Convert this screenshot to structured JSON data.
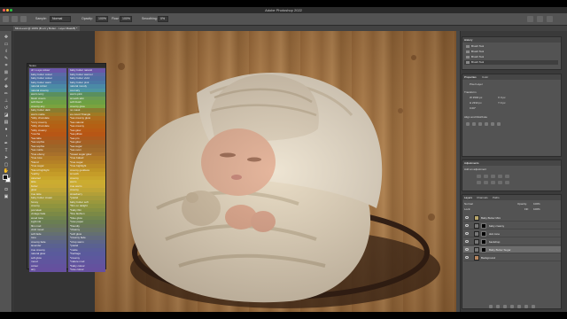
{
  "window": {
    "title": "Adobe Photoshop 2022"
  },
  "document": {
    "tab_label": "Mini-Level @ 100% (B a b y Butter... Layer Mask/8) *"
  },
  "options_bar": {
    "sample_label": "Sample:",
    "sample_value": "Normal",
    "opacity_label": "Opacity:",
    "opacity_value": "100%",
    "flow_label": "Flow:",
    "flow_value": "100%",
    "smoothing_label": "Smoothing:",
    "smoothing_value": "0%"
  },
  "notes_panel": {
    "title": "Notes",
    "left_column": [
      {
        "label": "dr t s eye colour",
        "color": "#6a56a8"
      },
      {
        "label": "baby butter colour",
        "color": "#5a6aa6"
      },
      {
        "label": "baby butter colour",
        "color": "#4f6ea3"
      },
      {
        "label": "baby butter warm",
        "color": "#4a78a4"
      },
      {
        "label": "natural colour",
        "color": "#4b8aa6"
      },
      {
        "label": "natural creamy",
        "color": "#4d95a0"
      },
      {
        "label": "warm ivory",
        "color": "#5a8f5e"
      },
      {
        "label": "blush cream",
        "color": "#6b9a53"
      },
      {
        "label": "soft blend",
        "color": "#6da043"
      },
      {
        "label": "creamy airy",
        "color": "#7aa33e"
      },
      {
        "label": "baby butter dark",
        "color": "#8a7c2f"
      },
      {
        "label": "warm matte",
        "color": "#a07a24"
      },
      {
        "label": "*silky chocolate",
        "color": "#ad6c1d"
      },
      {
        "label": "*cozy creamy",
        "color": "#b06417"
      },
      {
        "label": "*silky chocolate",
        "color": "#b46014"
      },
      {
        "label": "*silky creamy",
        "color": "#b85a14"
      },
      {
        "label": "*mocha",
        "color": "#b75615"
      },
      {
        "label": "*tea latte",
        "color": "#ad5a1c"
      },
      {
        "label": "*tea sophia",
        "color": "#a46024"
      },
      {
        "label": "*tea sophia",
        "color": "#9d6528"
      },
      {
        "label": "*tea matte",
        "color": "#a06a2a"
      },
      {
        "label": "*true ebony",
        "color": "#a8702a"
      },
      {
        "label": "*true luxe",
        "color": "#b07a27"
      },
      {
        "label": "*blend",
        "color": "#b58126"
      },
      {
        "label": "*true sugar",
        "color": "#ba8a25"
      },
      {
        "label": "*blend highlight",
        "color": "#bf9425"
      },
      {
        "label": "*earthy",
        "color": "#c59c28"
      },
      {
        "label": "caramel",
        "color": "#c9a52c"
      },
      {
        "label": "latte",
        "color": "#cbac30"
      },
      {
        "label": "butter",
        "color": "#caa933"
      },
      {
        "label": "glow",
        "color": "#bfa535"
      },
      {
        "label": "true latte",
        "color": "#b29f38"
      },
      {
        "label": "baby butter cream",
        "color": "#a59a3a"
      },
      {
        "label": "honey",
        "color": "#9a983c"
      },
      {
        "label": "creamy",
        "color": "#8f943e"
      },
      {
        "label": "porcelain",
        "color": "#858f42"
      },
      {
        "label": "vintage fade",
        "color": "#7b8946"
      },
      {
        "label": "wood tone",
        "color": "#71844c"
      },
      {
        "label": "Light ink",
        "color": "#6a7e52"
      },
      {
        "label": "film mod",
        "color": "#6a785a"
      },
      {
        "label": "vivid mood",
        "color": "#687466"
      },
      {
        "label": "soft fade",
        "color": "#646f72"
      },
      {
        "label": "tone",
        "color": "#61697d"
      },
      {
        "label": "creamy fade",
        "color": "#5d6588"
      },
      {
        "label": "lavender",
        "color": "#5a6190"
      },
      {
        "label": "true creamy",
        "color": "#5a5d98"
      },
      {
        "label": "natural glow",
        "color": "#5a5a9c"
      },
      {
        "label": "soft glow",
        "color": "#5d589d"
      },
      {
        "label": "mood",
        "color": "#60559e"
      },
      {
        "label": "colour",
        "color": "#63529e"
      },
      {
        "label": "airy",
        "color": "#66509e"
      }
    ],
    "right_column": [
      {
        "label": "baby butter natural",
        "color": "#6a56a8"
      },
      {
        "label": "baby butter warmer",
        "color": "#5a6aa6"
      },
      {
        "label": "baby butter vivid",
        "color": "#4f6ea3"
      },
      {
        "label": "baby butter pink",
        "color": "#4a78a4"
      },
      {
        "label": "natural moody",
        "color": "#4b8aa6"
      },
      {
        "label": "cool airy",
        "color": "#4d95a0"
      },
      {
        "label": "warm pink",
        "color": "#5a8f5e"
      },
      {
        "label": "smooth skin",
        "color": "#6b9a53"
      },
      {
        "label": "soft blush",
        "color": "#6da043"
      },
      {
        "label": "creamy glow",
        "color": "#7aa33e"
      },
      {
        "label": "no mask",
        "color": "#8a7c2f"
      },
      {
        "label": "ex-mood Triangle",
        "color": "#a07a24"
      },
      {
        "label": "*tea creamy glow",
        "color": "#ad6c1d"
      },
      {
        "label": "*tea natural",
        "color": "#b06417"
      },
      {
        "label": "*tea creamy",
        "color": "#b46014"
      },
      {
        "label": "*tea glow",
        "color": "#b85a14"
      },
      {
        "label": "*tea pillow",
        "color": "#b75615"
      },
      {
        "label": "*tea pro",
        "color": "#ad5a1c"
      },
      {
        "label": "*tea glow",
        "color": "#a46024"
      },
      {
        "label": "*tea sugar",
        "color": "#9d6528"
      },
      {
        "label": "*tea oven",
        "color": "#a06a2a"
      },
      {
        "label": "*sweet sugar glow",
        "color": "#a8702a"
      },
      {
        "label": "*true baked",
        "color": "#b07a27"
      },
      {
        "label": "*true sugar",
        "color": "#b58126"
      },
      {
        "label": "*true highlight",
        "color": "#ba8a25"
      },
      {
        "label": "creamy goddess",
        "color": "#bf9425"
      },
      {
        "label": "smooth",
        "color": "#c59c28"
      },
      {
        "label": "creamy",
        "color": "#c9a52c"
      },
      {
        "label": "warm",
        "color": "#cbac30"
      },
      {
        "label": "true warm",
        "color": "#caa933"
      },
      {
        "label": "creamy",
        "color": "#bfa535"
      },
      {
        "label": "strawberry",
        "color": "#b29f38"
      },
      {
        "label": "*pastel",
        "color": "#a59a3a"
      },
      {
        "label": "baby butter soft",
        "color": "#9a983c"
      },
      {
        "label": "*film on delight",
        "color": "#8f943e"
      },
      {
        "label": "*baby film",
        "color": "#858f42"
      },
      {
        "label": "*fine fashion",
        "color": "#7b8946"
      },
      {
        "label": "*blue glow",
        "color": "#71844c"
      },
      {
        "label": "*luxe paper",
        "color": "#6a7e52"
      },
      {
        "label": "*friendly",
        "color": "#6a785a"
      },
      {
        "label": "*dreamy",
        "color": "#687466"
      },
      {
        "label": "*soft glow",
        "color": "#646f72"
      },
      {
        "label": "*creamy fade",
        "color": "#61697d"
      },
      {
        "label": "*crisp warm",
        "color": "#5d6588"
      },
      {
        "label": "*pastel",
        "color": "#5a6190"
      },
      {
        "label": "*matte",
        "color": "#5a5d98"
      },
      {
        "label": "*heritage",
        "color": "#5a5a9c"
      },
      {
        "label": "*creamy",
        "color": "#5d589d"
      },
      {
        "label": "*nature mod",
        "color": "#60559e"
      },
      {
        "label": "*baby colour",
        "color": "#63529e"
      },
      {
        "label": "*luxe colour",
        "color": "#66509e"
      }
    ]
  },
  "history_panel": {
    "tab": "History",
    "items": [
      {
        "label": "Brush Tool"
      },
      {
        "label": "Brush Tool"
      },
      {
        "label": "Brush Tool"
      },
      {
        "label": "Brush Tool"
      }
    ]
  },
  "properties_panel": {
    "tabs": [
      "Properties",
      "Color"
    ],
    "kind": "Pixel Layer",
    "transform_label": "Transform",
    "width": "W 3500 px",
    "height": "H 2333 px",
    "x": "X 0 px",
    "y": "Y 0 px",
    "angle": "0.00°",
    "align_label": "Align and Distribute"
  },
  "adjustments_panel": {
    "title": "Adjustments",
    "subtitle": "Add an adjustment"
  },
  "layers_panel": {
    "tabs": [
      "Layers",
      "Channels",
      "Paths"
    ],
    "blend_mode": "Normal",
    "opacity_label": "Opacity:",
    "opacity_value": "100%",
    "lock_label": "Lock:",
    "fill_label": "Fill:",
    "fill_value": "100%",
    "layers": [
      {
        "name": "Baby Butter Mini",
        "type": "group",
        "selected": false
      },
      {
        "name": "baby creamy",
        "type": "adjust",
        "selected": false
      },
      {
        "name": "skin tone",
        "type": "adjust",
        "selected": false
      },
      {
        "name": "backdrop",
        "type": "adjust",
        "selected": false
      },
      {
        "name": "Baby Butter Sugar",
        "type": "adjust",
        "selected": true
      },
      {
        "name": "Background",
        "type": "pixel",
        "selected": false
      }
    ]
  }
}
